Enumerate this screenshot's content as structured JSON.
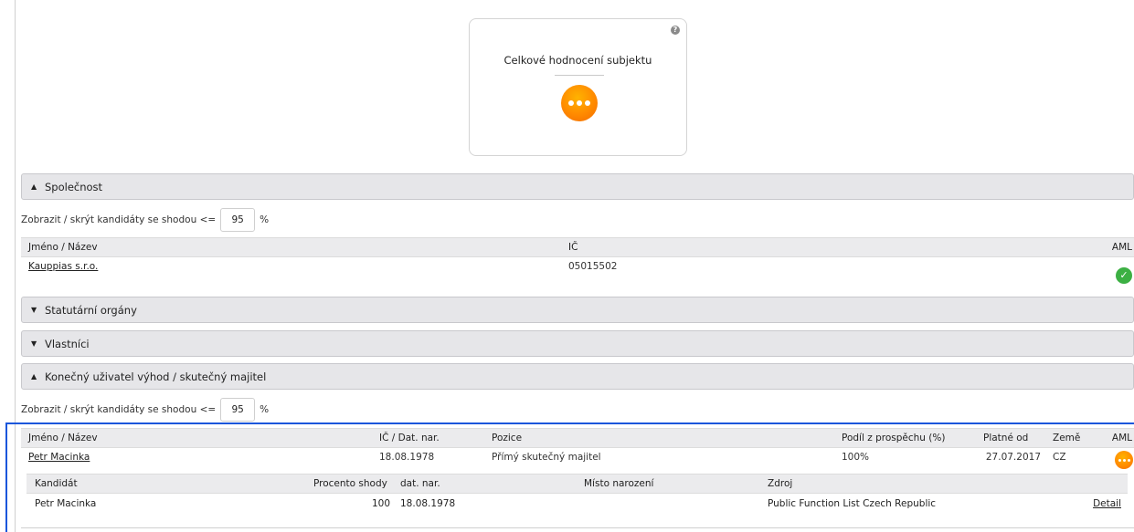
{
  "rating": {
    "title": "Celkové hodnocení subjektu",
    "help": "?"
  },
  "sections": {
    "company": {
      "label": "Společnost",
      "expanded": true
    },
    "statutory": {
      "label": "Statutární orgány",
      "expanded": false
    },
    "owners": {
      "label": "Vlastníci",
      "expanded": false
    },
    "ubo": {
      "label": "Konečný uživatel výhod / skutečný majitel",
      "expanded": true
    }
  },
  "filter": {
    "label": "Zobrazit / skrýt kandidáty se shodou <=",
    "value": "95",
    "unit": "%"
  },
  "company_table": {
    "headers": {
      "name": "Jméno / Název",
      "ic": "IČ",
      "aml": "AML"
    },
    "rows": [
      {
        "name": "Kauppias s.r.o.",
        "ic": "05015502",
        "aml": "ok"
      }
    ]
  },
  "ubo_table": {
    "headers": {
      "name": "Jméno / Název",
      "ic_dob": "IČ / Dat. nar.",
      "position": "Pozice",
      "share": "Podíl z prospěchu (%)",
      "valid_from": "Platné od",
      "country": "Země",
      "aml": "AML"
    },
    "rows": [
      {
        "name": "Petr Macinka",
        "ic_dob": "18.08.1978",
        "position": "Přímý skutečný majitel",
        "share": "100%",
        "valid_from": "27.07.2017",
        "country": "CZ",
        "aml": "pending"
      }
    ]
  },
  "candidates": {
    "headers": {
      "candidate": "Kandidát",
      "match": "Procento shody",
      "dob": "dat. nar.",
      "birthplace": "Místo narození",
      "source": "Zdroj"
    },
    "rows": [
      {
        "candidate": "Petr Macinka",
        "match": "100",
        "dob": "18.08.1978",
        "birthplace": "",
        "source": "Public Function List Czech Republic",
        "detail": "Detail"
      }
    ]
  },
  "colors": {
    "accent_highlight": "#1a56db",
    "aml_ok": "#3cb043",
    "aml_pending": "#ff8a00",
    "header_bg": "#e6e6e9"
  }
}
